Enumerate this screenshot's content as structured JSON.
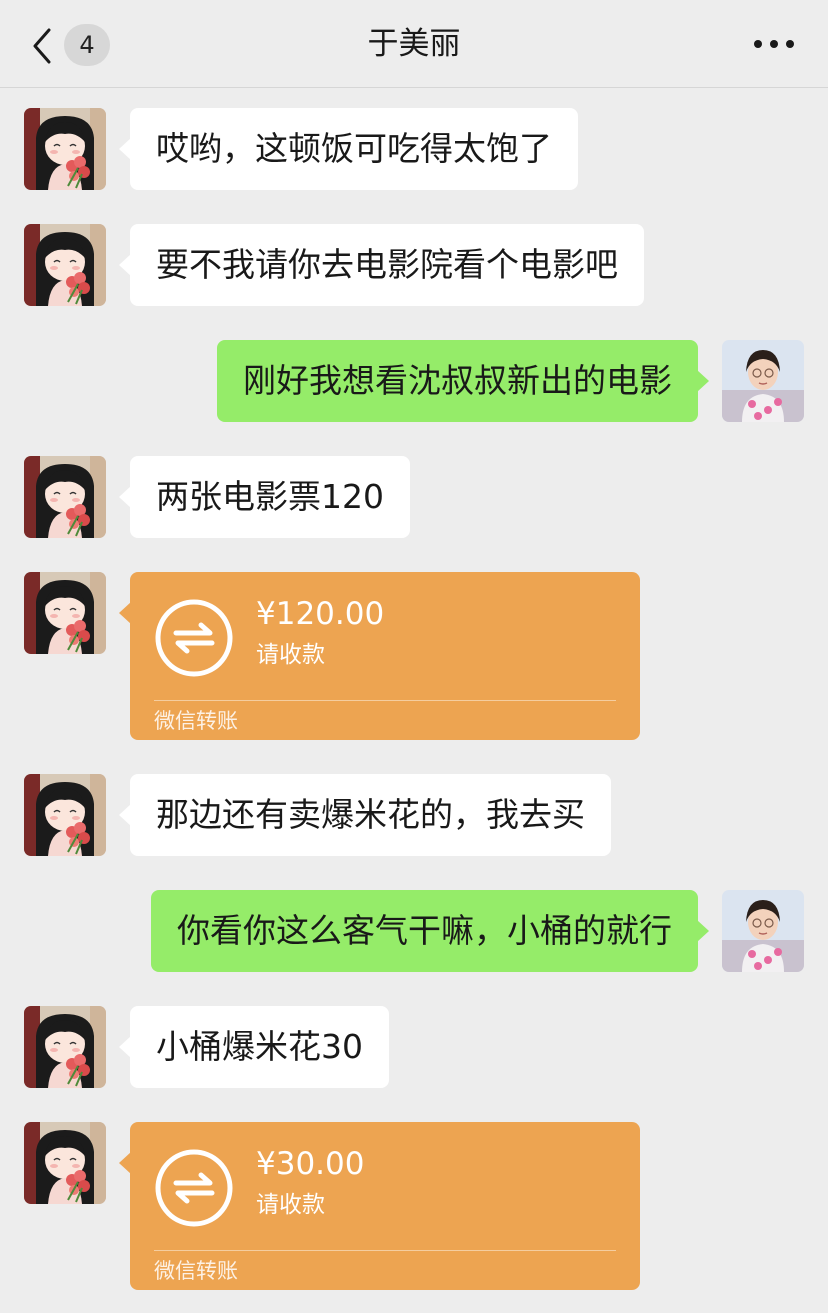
{
  "header": {
    "back_icon": "chevron-left-icon",
    "unread_count": "4",
    "title": "于美丽",
    "more_icon": "more-dots-icon"
  },
  "colors": {
    "background": "#ededed",
    "incoming_bubble": "#ffffff",
    "outgoing_bubble": "#95ec69",
    "transfer_card": "#eda451"
  },
  "messages": [
    {
      "sender": "them",
      "type": "text",
      "text": "哎哟，这顿饭可吃得太饱了"
    },
    {
      "sender": "them",
      "type": "text",
      "text": "要不我请你去电影院看个电影吧"
    },
    {
      "sender": "me",
      "type": "text",
      "text": "刚好我想看沈叔叔新出的电影"
    },
    {
      "sender": "them",
      "type": "text",
      "text": "两张电影票120"
    },
    {
      "sender": "them",
      "type": "transfer",
      "amount": "¥120.00",
      "note": "请收款",
      "label": "微信转账",
      "icon": "transfer-arrows-icon"
    },
    {
      "sender": "them",
      "type": "text",
      "text": "那边还有卖爆米花的，我去买"
    },
    {
      "sender": "me",
      "type": "text",
      "text": "你看你这么客气干嘛，小桶的就行"
    },
    {
      "sender": "them",
      "type": "text",
      "text": "小桶爆米花30"
    },
    {
      "sender": "them",
      "type": "transfer",
      "amount": "¥30.00",
      "note": "请收款",
      "label": "微信转账",
      "icon": "transfer-arrows-icon"
    }
  ]
}
